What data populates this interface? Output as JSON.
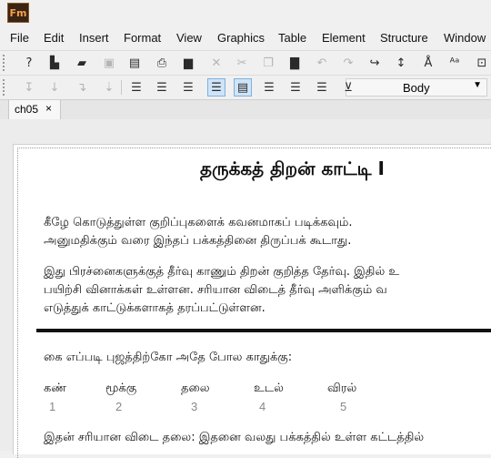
{
  "app": {
    "logo_text": "Fm"
  },
  "menu": [
    "File",
    "Edit",
    "Insert",
    "Format",
    "View",
    "Graphics",
    "Table",
    "Element",
    "Structure",
    "Window"
  ],
  "toolbar1": [
    {
      "icon": "help-icon",
      "glyph": "?",
      "enabled": true
    },
    {
      "icon": "new-doc-icon",
      "glyph": "▙",
      "enabled": true
    },
    {
      "icon": "open-folder-icon",
      "glyph": "▰",
      "enabled": true
    },
    {
      "icon": "save-icon",
      "glyph": "▣",
      "enabled": false
    },
    {
      "icon": "save-as-icon",
      "glyph": "▤",
      "enabled": true
    },
    {
      "icon": "print-icon",
      "glyph": "⎙",
      "enabled": true
    },
    {
      "icon": "lock-icon",
      "glyph": "▆",
      "enabled": true
    },
    {
      "icon": "delete-icon",
      "glyph": "✕",
      "enabled": false
    },
    {
      "icon": "cut-icon",
      "glyph": "✂",
      "enabled": false
    },
    {
      "icon": "copy-icon",
      "glyph": "❐",
      "enabled": false
    },
    {
      "icon": "paste-icon",
      "glyph": "▇",
      "enabled": true
    },
    {
      "icon": "undo-icon",
      "glyph": "↶",
      "enabled": false
    },
    {
      "icon": "redo-icon",
      "glyph": "↷",
      "enabled": false
    },
    {
      "icon": "cross-reference-icon",
      "glyph": "↪",
      "enabled": true
    },
    {
      "icon": "insert-variable-icon",
      "glyph": "↕",
      "enabled": true
    },
    {
      "icon": "spelling-icon",
      "glyph": "Å",
      "enabled": true
    },
    {
      "icon": "change-case-icon",
      "glyph": "ᴬᵃ",
      "enabled": true
    },
    {
      "icon": "text-frame-icon",
      "glyph": "⊡",
      "enabled": true
    }
  ],
  "toolbar2": [
    {
      "icon": "indent-first-icon",
      "glyph": "↧",
      "enabled": false,
      "selected": false
    },
    {
      "icon": "indent-left-icon",
      "glyph": "↓",
      "enabled": false,
      "selected": false
    },
    {
      "icon": "indent-right-icon",
      "glyph": "↴",
      "enabled": false,
      "selected": false
    },
    {
      "icon": "indent-more-icon",
      "glyph": "⇣",
      "enabled": false,
      "selected": false
    },
    {
      "icon": "align-left-icon",
      "glyph": "☰",
      "enabled": true,
      "selected": false
    },
    {
      "icon": "align-center-icon",
      "glyph": "☰",
      "enabled": true,
      "selected": false
    },
    {
      "icon": "align-right-icon",
      "glyph": "☰",
      "enabled": true,
      "selected": false
    },
    {
      "icon": "align-justify-icon",
      "glyph": "☰",
      "enabled": true,
      "selected": true
    },
    {
      "icon": "line-spacing-icon",
      "glyph": "▤",
      "enabled": true,
      "selected": true
    },
    {
      "icon": "spacing-single-icon",
      "glyph": "☰",
      "enabled": true,
      "selected": false
    },
    {
      "icon": "spacing-half-icon",
      "glyph": "☰",
      "enabled": true,
      "selected": false
    },
    {
      "icon": "spacing-double-icon",
      "glyph": "☰",
      "enabled": true,
      "selected": false
    },
    {
      "icon": "tab-stop-icon",
      "glyph": "⊻",
      "enabled": true,
      "selected": false
    }
  ],
  "style_select": {
    "value": "Body"
  },
  "doc_tab": {
    "label": "ch05",
    "close": "×"
  },
  "content": {
    "title": "தருக்கத் திறன் காட்டி I",
    "para1_line1": "கீழே கொடுத்துள்ள குறிப்புகளைக் கவனமாகப் படிக்கவும்.",
    "para1_line2": "அனுமதிக்கும் வரை இந்தப் பக்கத்தினை திருப்பக் கூடாது.",
    "para2_line1": "இது பிரச்னைகளுக்குத் தீர்வு காணும் திறன் குறித்த தேர்வு. இதில் உ",
    "para2_line2": "பயிற்சி வினாக்கள் உள்ளன. சரியான விடைத் தீர்வு அளிக்கும் வ",
    "para2_line3": "எடுத்துக் காட்டுக்களாகத் தரப்பட்டுள்ளன.",
    "question": "கை எப்படி புஜத்திற்கோ அதே போல காதுக்கு:",
    "options": [
      {
        "word": "கண்",
        "num": "1"
      },
      {
        "word": "மூக்கு",
        "num": "2"
      },
      {
        "word": "தலை",
        "num": "3"
      },
      {
        "word": "உடல்",
        "num": "4"
      },
      {
        "word": "விரல்",
        "num": "5"
      }
    ],
    "answer": "இதன் சரியான விடை தலை: இதனை வலது பக்கத்தில் உள்ள கட்டத்தில்"
  }
}
